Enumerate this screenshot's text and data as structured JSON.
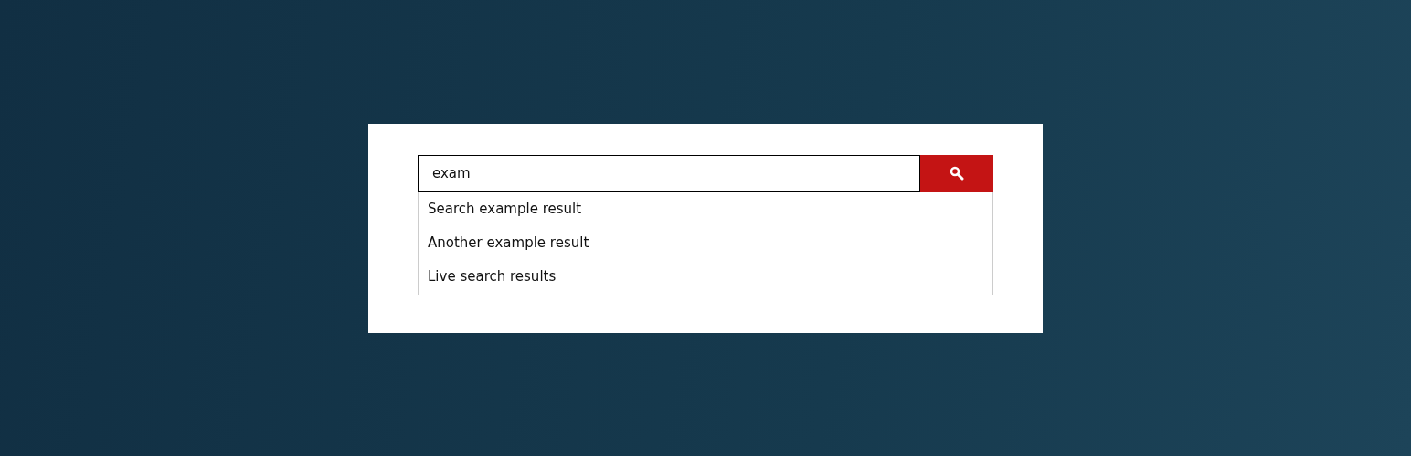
{
  "search": {
    "value": "exam"
  },
  "results": [
    {
      "label": "Search example result"
    },
    {
      "label": "Another example result"
    },
    {
      "label": "Live search results"
    }
  ]
}
